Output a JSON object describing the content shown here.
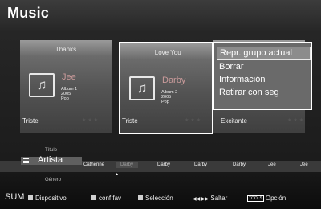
{
  "title": "Music",
  "cards": [
    {
      "song": "Thanks",
      "artist": "Jee",
      "album": "Album 1",
      "year": "2005",
      "genre": "Pop",
      "mood": "Triste"
    },
    {
      "song": "I Love You",
      "artist": "Darby",
      "album": "Album 2",
      "year": "2005",
      "genre": "Pop",
      "mood": "Triste"
    },
    {
      "mood": "Excitante"
    }
  ],
  "context_menu": [
    "Repr. grupo actual",
    "Borrar",
    "Información",
    "Retirar con seg"
  ],
  "sort": {
    "above": "Título",
    "current": "Artista",
    "below": "Género"
  },
  "strip": [
    "Catherine",
    "Darby",
    "Darby",
    "Darby",
    "Darby",
    "Jee",
    "Jee"
  ],
  "bottom": {
    "brand": "SUM",
    "items": [
      "Dispositivo",
      "conf fav",
      "Selección",
      "Saltar",
      "Opción"
    ],
    "tools_label": "TOOLS",
    "skip_arrows": "◀◀ ▶▶"
  },
  "icons": {
    "music_note": "music-note-icon"
  }
}
